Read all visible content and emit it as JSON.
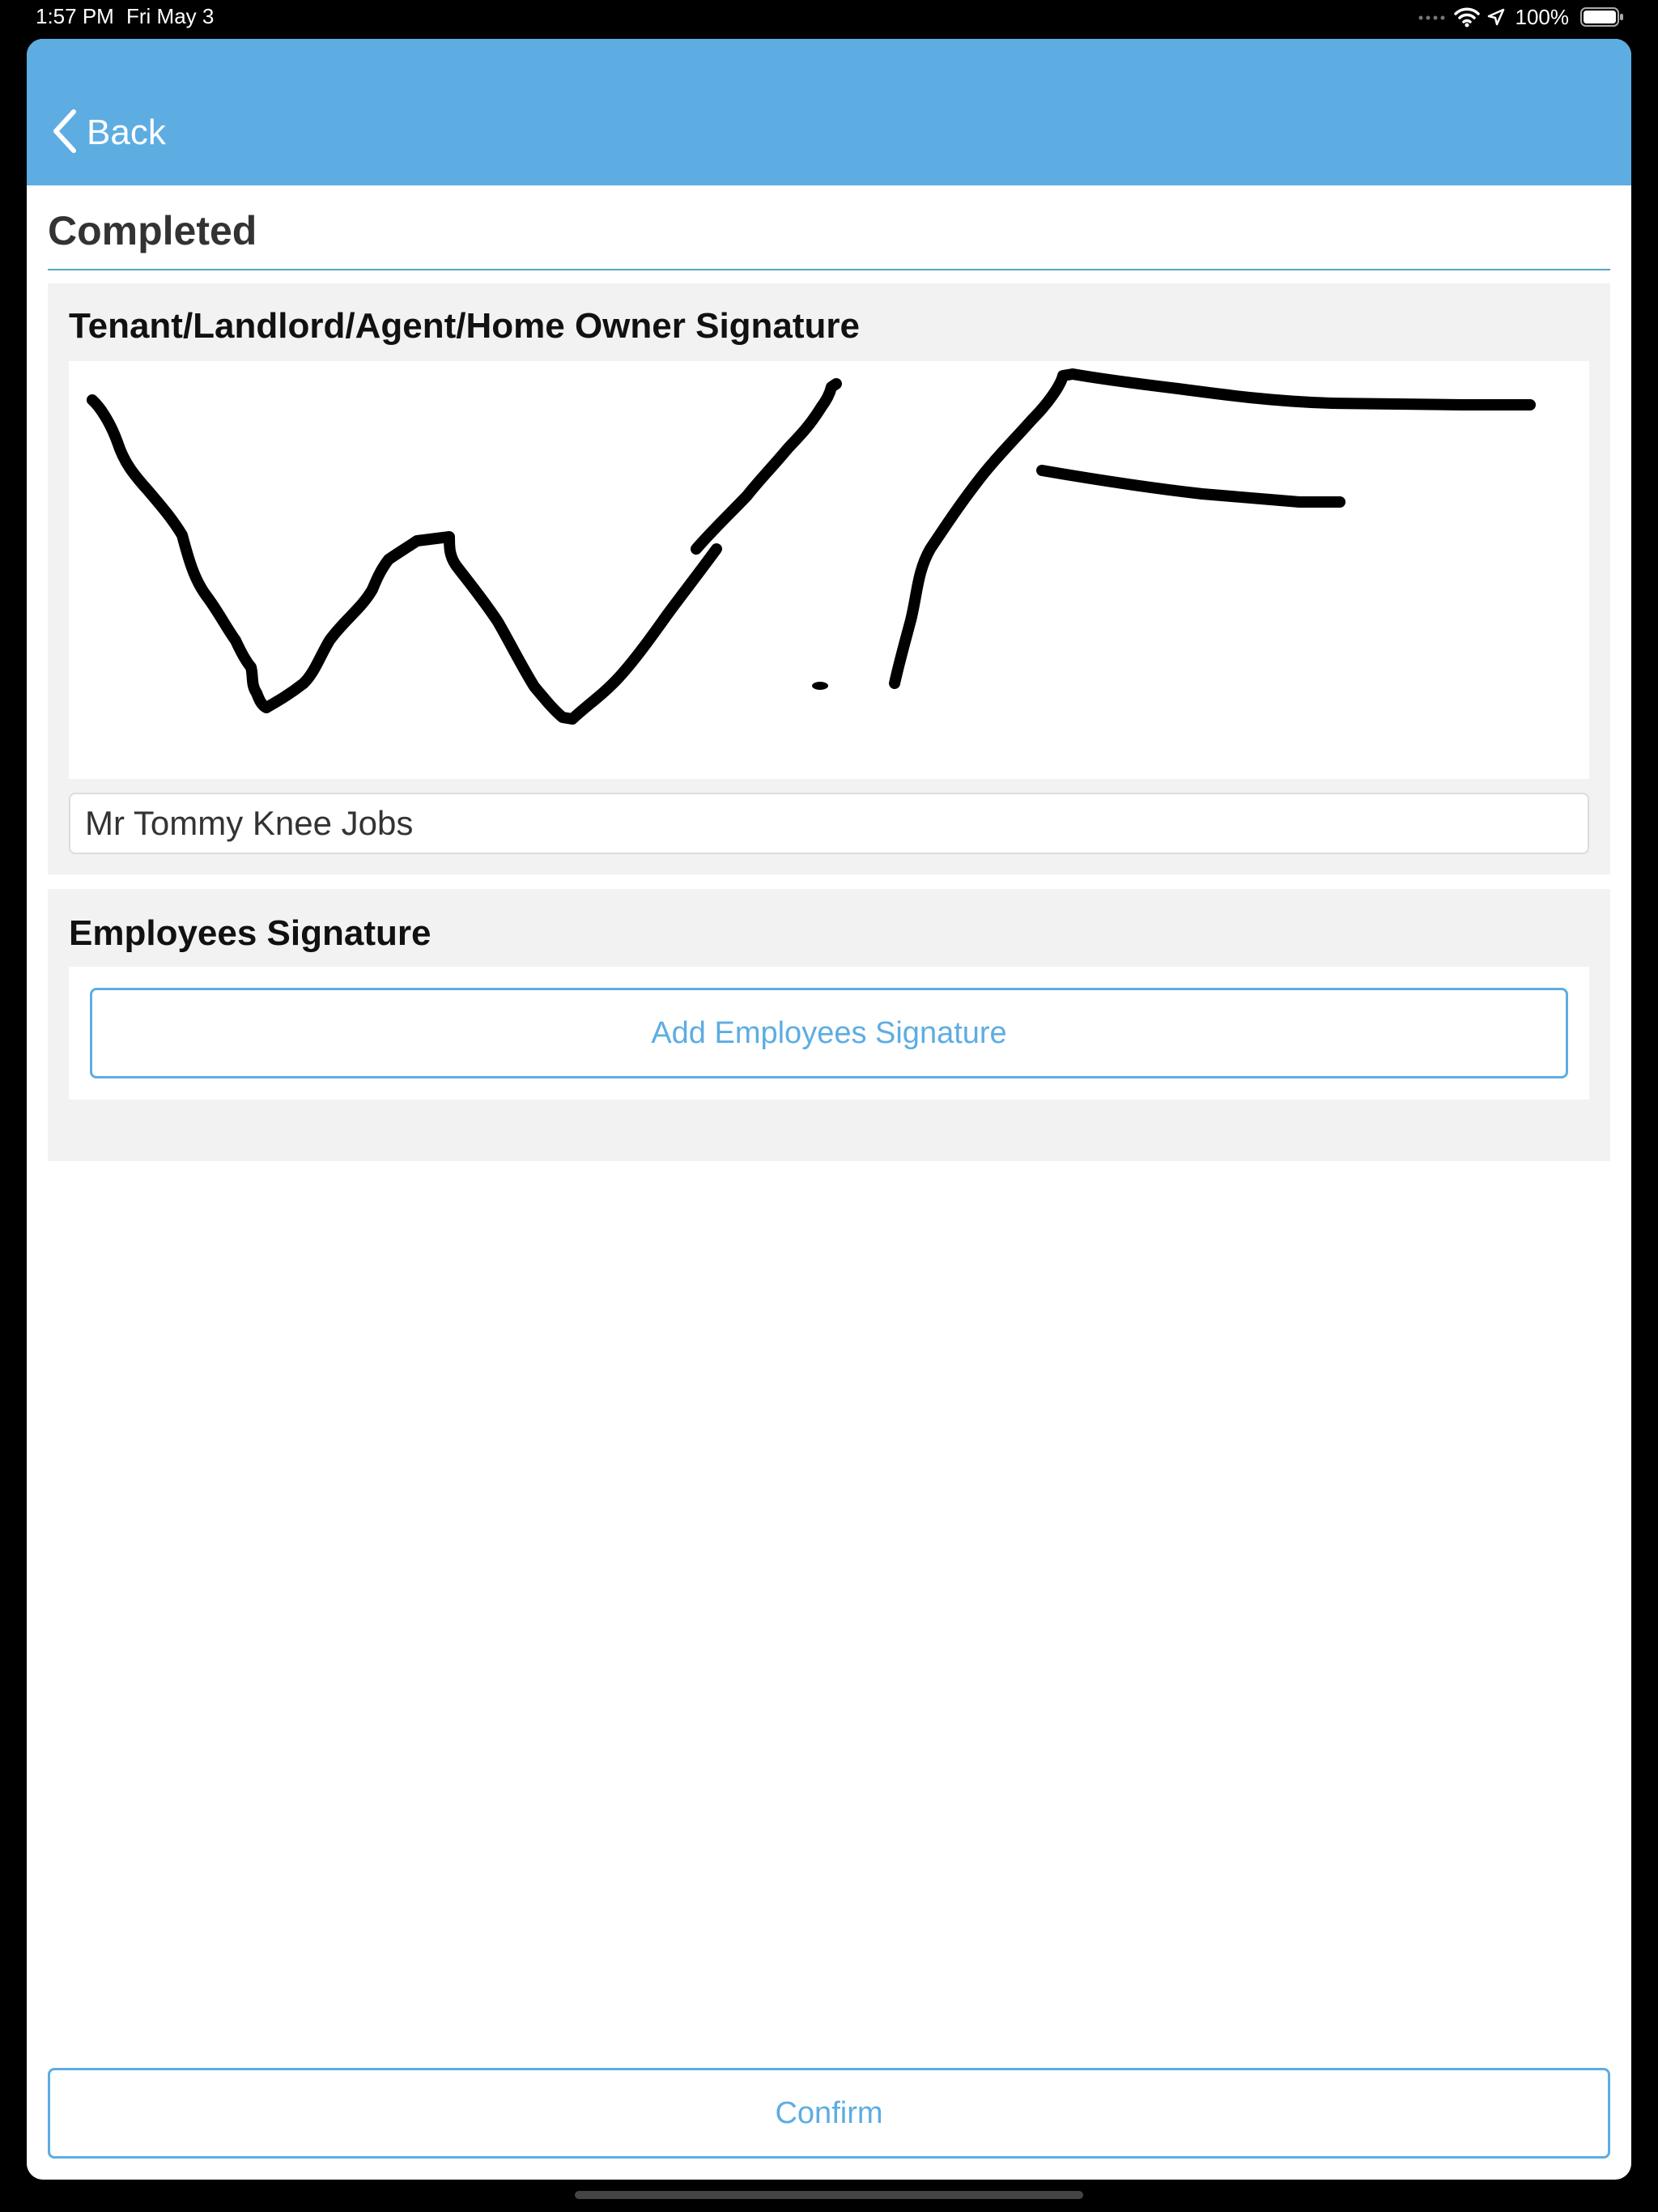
{
  "status_bar": {
    "time": "1:57 PM",
    "date": "Fri May 3",
    "battery": "100%"
  },
  "nav": {
    "back_label": "Back"
  },
  "page": {
    "title": "Completed"
  },
  "customer_signature": {
    "heading": "Tenant/Landlord/Agent/Home Owner Signature",
    "name_value": "Mr Tommy Knee Jobs"
  },
  "employee_signature": {
    "heading": "Employees Signature",
    "add_button_label": "Add Employees Signature"
  },
  "footer": {
    "confirm_label": "Confirm"
  },
  "colors": {
    "accent": "#5dade2",
    "panel_background": "#f2f2f2"
  },
  "icons": [
    "wifi-icon",
    "location-arrow-icon",
    "battery-icon",
    "chevron-left-icon"
  ]
}
